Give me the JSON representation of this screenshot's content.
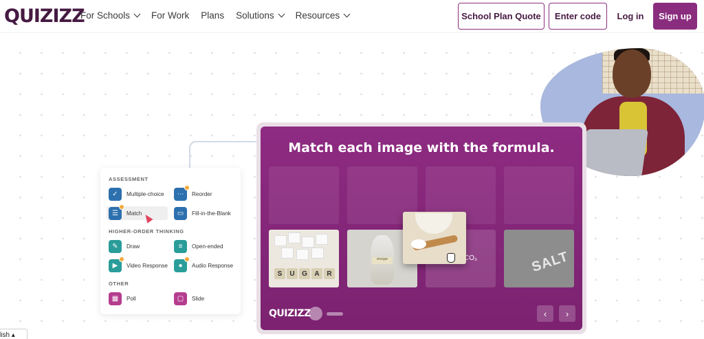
{
  "header": {
    "logo": "QUIZIZZ",
    "nav": [
      {
        "label": "For Schools",
        "dropdown": true
      },
      {
        "label": "For Work",
        "dropdown": false
      },
      {
        "label": "Plans",
        "dropdown": false
      },
      {
        "label": "Solutions",
        "dropdown": true
      },
      {
        "label": "Resources",
        "dropdown": true
      }
    ],
    "buttons": {
      "quote": "School Plan Quote",
      "code": "Enter code",
      "login": "Log in",
      "signup": "Sign up"
    }
  },
  "question_types": {
    "sections": {
      "assessment": "ASSESSMENT",
      "higher_order": "HIGHER-ORDER THINKING",
      "other": "OTHER"
    },
    "items": {
      "multiple_choice": "Multiple-choice",
      "reorder": "Reorder",
      "match": "Match",
      "fill_blank": "Fill-in-the-Blank",
      "draw": "Draw",
      "open_ended": "Open-ended",
      "video_response": "Video Response",
      "audio_response": "Audio Response",
      "poll": "Poll",
      "slide": "Slide"
    }
  },
  "quiz_card": {
    "title": "Match each image with the formula.",
    "tiles": {
      "sugar_letters": [
        "S",
        "U",
        "G",
        "A",
        "R"
      ],
      "vinegar_label": "vinegar",
      "formula_fragment": "CO₃",
      "salt_text": "SALT"
    },
    "logo": "QUIZIZZ",
    "prev": "‹",
    "next": "›"
  },
  "language": {
    "label": "lish ▴"
  },
  "colors": {
    "brand": "#461a42",
    "accent": "#8a2d7e",
    "card": "#8e2b82"
  }
}
